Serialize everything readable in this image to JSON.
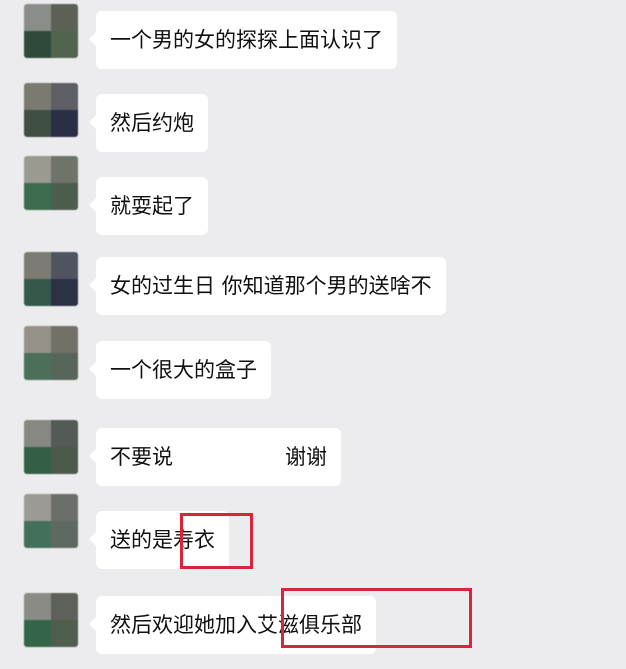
{
  "messages": [
    {
      "text": "一个男的女的探探上面认识了"
    },
    {
      "text": "然后约炮"
    },
    {
      "text": "就耍起了"
    },
    {
      "text": "女的过生日 你知道那个男的送啥不"
    },
    {
      "text": "一个很大的盒子"
    },
    {
      "text": "不要说",
      "text_right": "谢谢"
    },
    {
      "text": "送的是寿衣",
      "highlight": "寿衣"
    },
    {
      "text": "然后欢迎她加入艾滋俱乐部",
      "highlight": "艾滋俱乐部"
    }
  ],
  "colors": {
    "chat_background": "#ecebee",
    "bubble": "#ffffff",
    "highlight_border": "#d9253a"
  }
}
